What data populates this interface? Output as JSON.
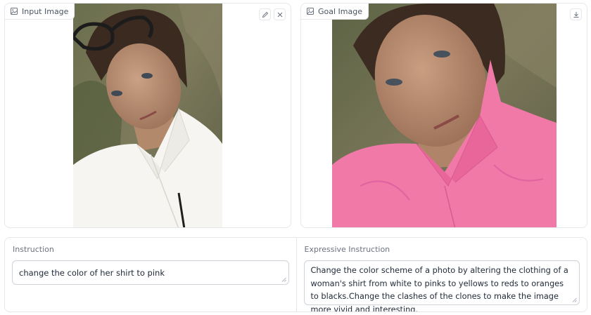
{
  "input_image": {
    "label": "Input Image",
    "label_icon": "image-icon",
    "tools": [
      "pencil-icon",
      "close-icon"
    ]
  },
  "goal_image": {
    "label": "Goal Image",
    "label_icon": "image-icon",
    "tools": [
      "download-icon"
    ]
  },
  "instruction": {
    "label": "Instruction",
    "value": "change the color of her shirt to pink"
  },
  "expressive_instruction": {
    "label": "Expressive Instruction",
    "value": "Change the color scheme of a photo by altering the clothing of a woman's shirt from white to pinks to yellows to reds to oranges to blacks.Change the clashes of the clones to make the image more vivid and interesting."
  },
  "colors": {
    "border": "#e5e7eb",
    "text": "#1f2937",
    "muted": "#6b7280",
    "shirt_original": "#f6f5f1",
    "shirt_goal": "#f079a8"
  }
}
